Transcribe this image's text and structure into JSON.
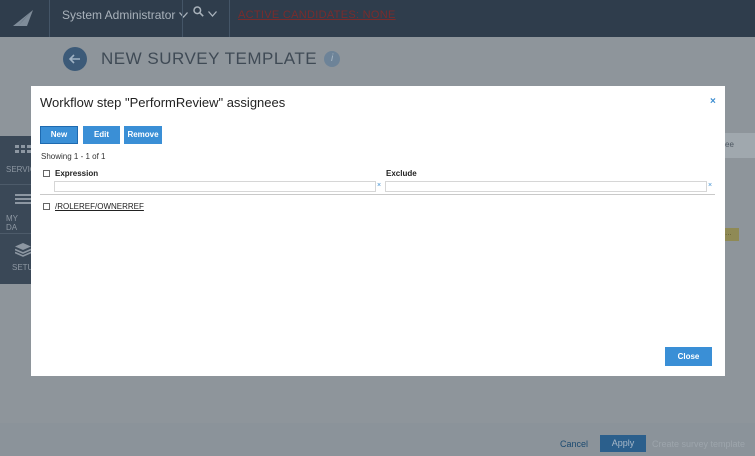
{
  "topbar": {
    "user_menu_label": "System Administrator",
    "alert_link": "ACTIVE CANDIDATES: NONE"
  },
  "leftnav": {
    "items": [
      {
        "label": "SERVIC",
        "icon": "grid-icon"
      },
      {
        "label": "MY DA",
        "icon": "menu-lines-icon"
      },
      {
        "label": "SETU",
        "icon": "layers-icon"
      }
    ]
  },
  "page": {
    "title": "NEW SURVEY TEMPLATE",
    "info_glyph": "i"
  },
  "background_fragments": {
    "right_text": "ee",
    "right_badge": "..."
  },
  "footer": {
    "cancel_label": "Cancel",
    "apply_label": "Apply",
    "create_label": "Create survey template"
  },
  "dialog": {
    "title": "Workflow step \"PerformReview\" assignees",
    "close_glyph": "×",
    "toolbar": {
      "new_label": "New",
      "edit_label": "Edit",
      "remove_label": "Remove"
    },
    "showing_text": "Showing 1 - 1 of 1",
    "columns": [
      "Expression",
      "Exclude"
    ],
    "filter_clear_glyph": "×",
    "rows": [
      {
        "expression": "/ROLEREF/OWNERREF",
        "exclude": ""
      }
    ],
    "close_button_label": "Close"
  },
  "colors": {
    "accent": "#3a8fd6",
    "topbar": "#2f3d4c",
    "overlay_bg": "#8e959b"
  }
}
